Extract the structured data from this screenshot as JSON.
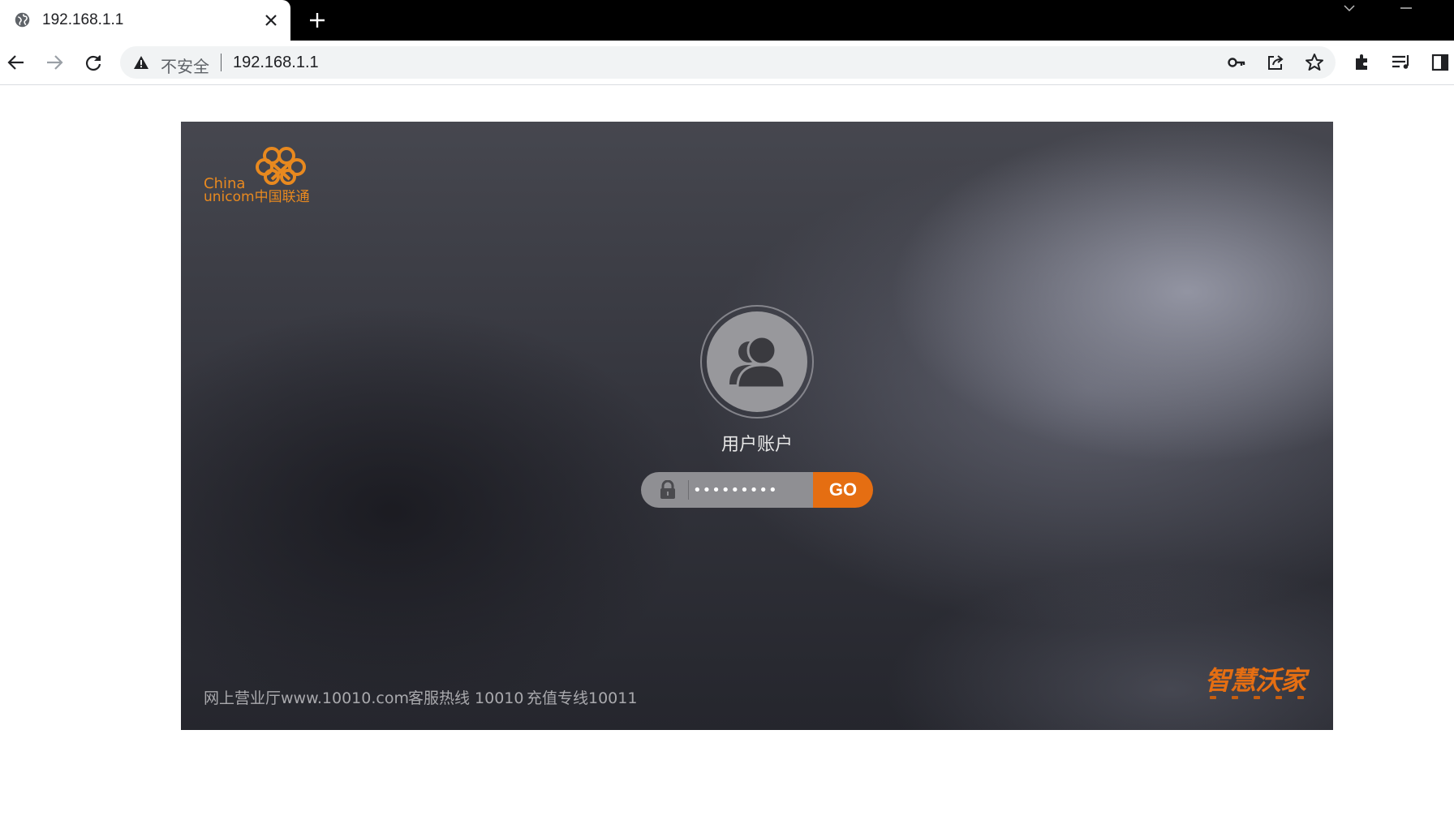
{
  "browser": {
    "tab_title": "192.168.1.1",
    "security_label": "不安全",
    "url": "192.168.1.1"
  },
  "page": {
    "logo": {
      "line1": "China",
      "line2": "unicom中国联通"
    },
    "account_label": "用户账户",
    "password_value": "•••••••••",
    "go_label": "GO",
    "footer": {
      "online_hall": "网上营业厅www.10010.com",
      "hotline": "客服热线 10010",
      "recharge": "充值专线10011"
    },
    "brand": "智慧沃家"
  },
  "colors": {
    "accent_orange": "#e56e12",
    "logo_orange": "#e8891f"
  }
}
